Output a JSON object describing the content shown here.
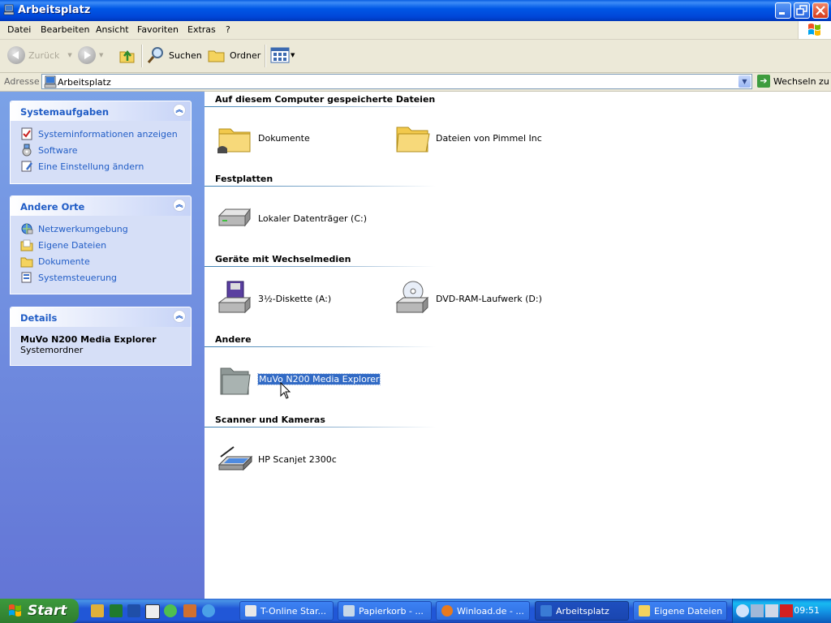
{
  "window": {
    "title": "Arbeitsplatz"
  },
  "menu": [
    "Datei",
    "Bearbeiten",
    "Ansicht",
    "Favoriten",
    "Extras",
    "?"
  ],
  "toolbar": {
    "back_label": "Zurück",
    "search_label": "Suchen",
    "folders_label": "Ordner"
  },
  "address": {
    "label": "Adresse",
    "value": "Arbeitsplatz",
    "go_label": "Wechseln zu"
  },
  "sidebar": {
    "system_tasks": {
      "title": "Systemaufgaben",
      "items": [
        {
          "label": "Systeminformationen anzeigen",
          "icon": "system-info-icon"
        },
        {
          "label": "Software",
          "icon": "software-icon"
        },
        {
          "label": "Eine Einstellung ändern",
          "icon": "settings-icon"
        }
      ]
    },
    "other_places": {
      "title": "Andere Orte",
      "items": [
        {
          "label": "Netzwerkumgebung",
          "icon": "network-icon"
        },
        {
          "label": "Eigene Dateien",
          "icon": "my-documents-icon"
        },
        {
          "label": "Dokumente",
          "icon": "folder-icon"
        },
        {
          "label": "Systemsteuerung",
          "icon": "control-panel-icon"
        }
      ]
    },
    "details": {
      "title": "Details",
      "name": "MuVo N200 Media Explorer",
      "type": "Systemordner"
    }
  },
  "groups": [
    {
      "title": "Auf diesem Computer gespeicherte Dateien",
      "items": [
        {
          "label": "Dokumente",
          "icon": "shared-folder-icon"
        },
        {
          "label": "Dateien von Pimmel Inc",
          "icon": "folder-icon"
        }
      ]
    },
    {
      "title": "Festplatten",
      "items": [
        {
          "label": "Lokaler Datenträger (C:)",
          "icon": "hard-drive-icon"
        }
      ]
    },
    {
      "title": "Geräte mit Wechselmedien",
      "items": [
        {
          "label": "3½-Diskette (A:)",
          "icon": "floppy-drive-icon"
        },
        {
          "label": "DVD-RAM-Laufwerk (D:)",
          "icon": "dvd-drive-icon"
        }
      ]
    },
    {
      "title": "Andere",
      "items": [
        {
          "label": "MuVo N200 Media Explorer",
          "icon": "system-folder-icon",
          "selected": true
        }
      ]
    },
    {
      "title": "Scanner und Kameras",
      "items": [
        {
          "label": "HP Scanjet 2300c",
          "icon": "scanner-icon"
        }
      ]
    }
  ],
  "taskbar": {
    "start_label": "Start",
    "buttons": [
      {
        "label": "T-Online Star...",
        "active": false
      },
      {
        "label": "Papierkorb - ...",
        "active": false
      },
      {
        "label": "Winload.de - ...",
        "active": false
      },
      {
        "label": "Arbeitsplatz",
        "active": true
      },
      {
        "label": "Eigene Dateien",
        "active": false
      }
    ],
    "clock": "09:51"
  },
  "colors": {
    "titlebar_blue": "#0058e6",
    "link_blue": "#215dc6",
    "selection": "#316ac5",
    "start_green": "#388e38"
  }
}
